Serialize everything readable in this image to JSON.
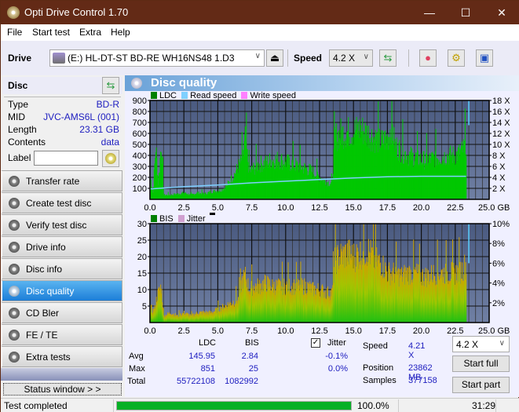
{
  "window": {
    "title": "Opti Drive Control 1.70",
    "minimize": "—",
    "maximize": "☐",
    "close": "✕"
  },
  "menu": {
    "file": "File",
    "start_test": "Start test",
    "extra": "Extra",
    "help": "Help"
  },
  "toolbar": {
    "drive_label": "Drive",
    "drive_value": "(E:)  HL-DT-ST BD-RE  WH16NS48 1.D3",
    "speed_label": "Speed",
    "speed_value": "4.2 X"
  },
  "disc": {
    "header": "Disc",
    "type_label": "Type",
    "type_value": "BD-R",
    "mid_label": "MID",
    "mid_value": "JVC-AMS6L (001)",
    "length_label": "Length",
    "length_value": "23.31 GB",
    "contents_label": "Contents",
    "contents_value": "data",
    "label_label": "Label",
    "label_value": ""
  },
  "nav": [
    {
      "label": "Transfer rate",
      "active": false
    },
    {
      "label": "Create test disc",
      "active": false
    },
    {
      "label": "Verify test disc",
      "active": false
    },
    {
      "label": "Drive info",
      "active": false
    },
    {
      "label": "Disc info",
      "active": false
    },
    {
      "label": "Disc quality",
      "active": true
    },
    {
      "label": "CD Bler",
      "active": false
    },
    {
      "label": "FE / TE",
      "active": false
    },
    {
      "label": "Extra tests",
      "active": false
    }
  ],
  "status_window": "Status window > >",
  "panel_title": "Disc quality",
  "colors": {
    "ldc": "#00c800",
    "read_speed": "#7fd0ff",
    "write_speed": "#ff80ff",
    "bis": "#008000",
    "jitter": "#d0a0d0",
    "plot_bg_top": "#4a5a80",
    "plot_bg_bottom": "#7080a4",
    "progress": "#06b025"
  },
  "chart_data": [
    {
      "type": "bar",
      "title": "LDC / Read speed",
      "legend": [
        "LDC",
        "Read speed",
        "Write speed"
      ],
      "legend_position": "top-left",
      "xlabel": "GB",
      "x_ticks": [
        "0.0",
        "2.5",
        "5.0",
        "7.5",
        "10.0",
        "12.5",
        "15.0",
        "17.5",
        "20.0",
        "22.5",
        "25.0 GB"
      ],
      "xlim": [
        0,
        25
      ],
      "ylim": [
        0,
        900
      ],
      "y_ticks": [
        "900",
        "800",
        "700",
        "600",
        "500",
        "400",
        "300",
        "200",
        "100"
      ],
      "y2_ticks": [
        "18 X",
        "16 X",
        "14 X",
        "12 X",
        "10 X",
        "8 X",
        "6 X",
        "4 X",
        "2 X"
      ],
      "y2lim": [
        0,
        18
      ],
      "grid": true,
      "series": [
        {
          "name": "LDC",
          "x": [
            0,
            0.2,
            0.4,
            0.6,
            0.8,
            1.0,
            1.5,
            2.0,
            2.5,
            3.0,
            3.5,
            4.0,
            4.5,
            5.0,
            5.3,
            5.6,
            5.9,
            6.2,
            6.5,
            6.8,
            7.0,
            7.3,
            7.6,
            8.0,
            8.5,
            9.0,
            9.5,
            10.0,
            10.5,
            11.0,
            11.5,
            12.0,
            12.5,
            13.0,
            13.4,
            13.6,
            14.0,
            14.5,
            15.0,
            15.5,
            16.0,
            16.5,
            17.0,
            17.5,
            17.8,
            18.0,
            18.5,
            19.0,
            19.5,
            20.0,
            20.5,
            21.0,
            21.5,
            22.0,
            22.5,
            23.0,
            23.3
          ],
          "values": [
            200,
            60,
            480,
            150,
            510,
            40,
            40,
            50,
            60,
            40,
            60,
            50,
            70,
            80,
            90,
            120,
            170,
            230,
            300,
            380,
            550,
            250,
            280,
            320,
            330,
            360,
            360,
            340,
            320,
            300,
            280,
            250,
            200,
            160,
            140,
            560,
            600,
            610,
            620,
            640,
            600,
            560,
            520,
            560,
            680,
            500,
            440,
            400,
            380,
            360,
            360,
            380,
            390,
            400,
            400,
            440,
            520
          ]
        },
        {
          "name": "Read speed",
          "unit": "X",
          "x": [
            0,
            2.5,
            5,
            7.5,
            10,
            12.5,
            15,
            17.5,
            20,
            22.5,
            23.3
          ],
          "values": [
            1.9,
            2.3,
            2.6,
            3.0,
            3.3,
            3.6,
            3.9,
            4.1,
            4.2,
            4.2,
            4.2
          ]
        },
        {
          "name": "Write speed",
          "unit": "X",
          "x": [],
          "values": []
        }
      ]
    },
    {
      "type": "bar",
      "title": "BIS / Jitter",
      "legend": [
        "BIS",
        "Jitter"
      ],
      "legend_position": "top-left",
      "xlabel": "GB",
      "x_ticks": [
        "0.0",
        "2.5",
        "5.0",
        "7.5",
        "10.0",
        "12.5",
        "15.0",
        "17.5",
        "20.0",
        "22.5",
        "25.0 GB"
      ],
      "xlim": [
        0,
        25
      ],
      "ylim": [
        0,
        30
      ],
      "y_ticks": [
        "30",
        "25",
        "20",
        "15",
        "10",
        "5"
      ],
      "y2_ticks": [
        "10%",
        "8%",
        "6%",
        "4%",
        "2%"
      ],
      "y2lim": [
        0,
        10
      ],
      "grid": true,
      "series": [
        {
          "name": "BIS",
          "x": [
            0,
            0.3,
            0.5,
            0.8,
            1.0,
            1.5,
            2.0,
            2.5,
            3.0,
            3.5,
            4.0,
            4.5,
            5.0,
            5.5,
            6.0,
            6.5,
            6.8,
            7.0,
            7.3,
            7.6,
            8.0,
            8.5,
            9.0,
            9.5,
            10.0,
            10.5,
            11.0,
            11.5,
            12.0,
            12.5,
            13.0,
            13.4,
            13.6,
            14.0,
            14.5,
            15.0,
            15.5,
            16.0,
            16.5,
            17.0,
            17.5,
            18.0,
            18.5,
            19.0,
            19.5,
            20.0,
            20.5,
            21.0,
            21.5,
            22.0,
            22.5,
            23.0,
            23.3
          ],
          "values": [
            3,
            4,
            8,
            11,
            2,
            3,
            2,
            3,
            2,
            3,
            3,
            3,
            4,
            5,
            6,
            7,
            13,
            14,
            10,
            11,
            11,
            12,
            11,
            11,
            11,
            11,
            11,
            11,
            10,
            10,
            9,
            9,
            19,
            20,
            21,
            20,
            21,
            22,
            19,
            18,
            15,
            15,
            14,
            15,
            15,
            14,
            14,
            15,
            15,
            15,
            15,
            16,
            18
          ]
        },
        {
          "name": "Jitter",
          "unit": "%",
          "x": [],
          "values": []
        }
      ]
    }
  ],
  "stats": {
    "col_ldc": "LDC",
    "col_bis": "BIS",
    "jitter_label": "Jitter",
    "jitter_checked": true,
    "avg_label": "Avg",
    "avg_ldc": "145.95",
    "avg_bis": "2.84",
    "avg_jitter": "-0.1%",
    "max_label": "Max",
    "max_ldc": "851",
    "max_bis": "25",
    "max_jitter": "0.0%",
    "total_label": "Total",
    "total_ldc": "55722108",
    "total_bis": "1082992",
    "speed_label": "Speed",
    "speed_value": "4.21 X",
    "position_label": "Position",
    "position_value": "23862 MB",
    "samples_label": "Samples",
    "samples_value": "377158",
    "speed_select": "4.2 X",
    "start_full": "Start full",
    "start_part": "Start part"
  },
  "statusbar": {
    "status": "Test completed",
    "progress": 100.0,
    "progress_text": "100.0%",
    "time": "31:29"
  }
}
